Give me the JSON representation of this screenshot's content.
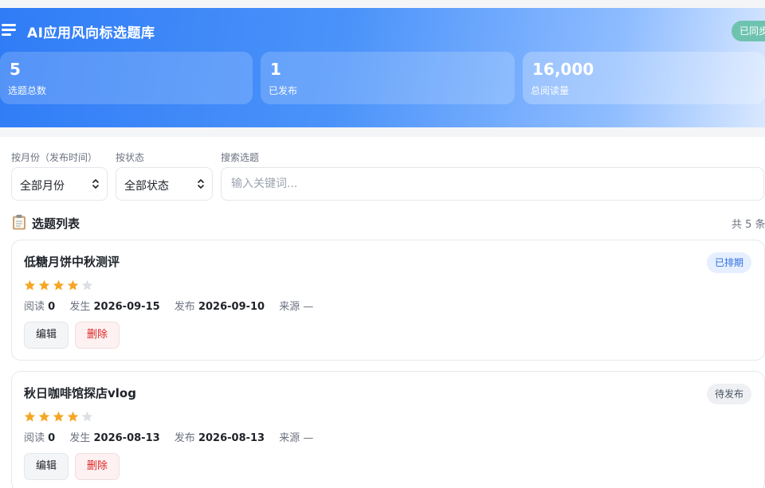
{
  "header": {
    "title": "AI应用风向标选题库",
    "sync_status": "已同步"
  },
  "stats": [
    {
      "value": "5",
      "label": "选题总数"
    },
    {
      "value": "1",
      "label": "已发布"
    },
    {
      "value": "16,000",
      "label": "总阅读量"
    }
  ],
  "filters": {
    "month_label": "按月份（发布时间）",
    "month_value": "全部月份",
    "status_label": "按状态",
    "status_value": "全部状态",
    "search_label": "搜索选题",
    "search_placeholder": "输入关键词...",
    "search_value": ""
  },
  "list": {
    "title": "选题列表",
    "count": "共 5 条",
    "icon": "clipboard-icon"
  },
  "labels": {
    "reads": "阅读",
    "happened": "发生",
    "published": "发布",
    "source": "来源",
    "edit": "编辑",
    "delete": "删除"
  },
  "items": [
    {
      "title": "低糖月饼中秋测评",
      "status": "已排期",
      "rating": 4,
      "rating_max": 5,
      "reads": "0",
      "happened": "2026-09-15",
      "published": "2026-09-10",
      "source": "—"
    },
    {
      "title": "秋日咖啡馆探店vlog",
      "status": "待发布",
      "rating": 4,
      "rating_max": 5,
      "reads": "0",
      "happened": "2026-08-13",
      "published": "2026-08-13",
      "source": "—"
    }
  ],
  "colors": {
    "accent": "#2f7cf6",
    "star_on": "#f5a623",
    "star_off": "#dcdfe4",
    "danger": "#dc2626",
    "sync_badge": "#6ec3b0"
  }
}
